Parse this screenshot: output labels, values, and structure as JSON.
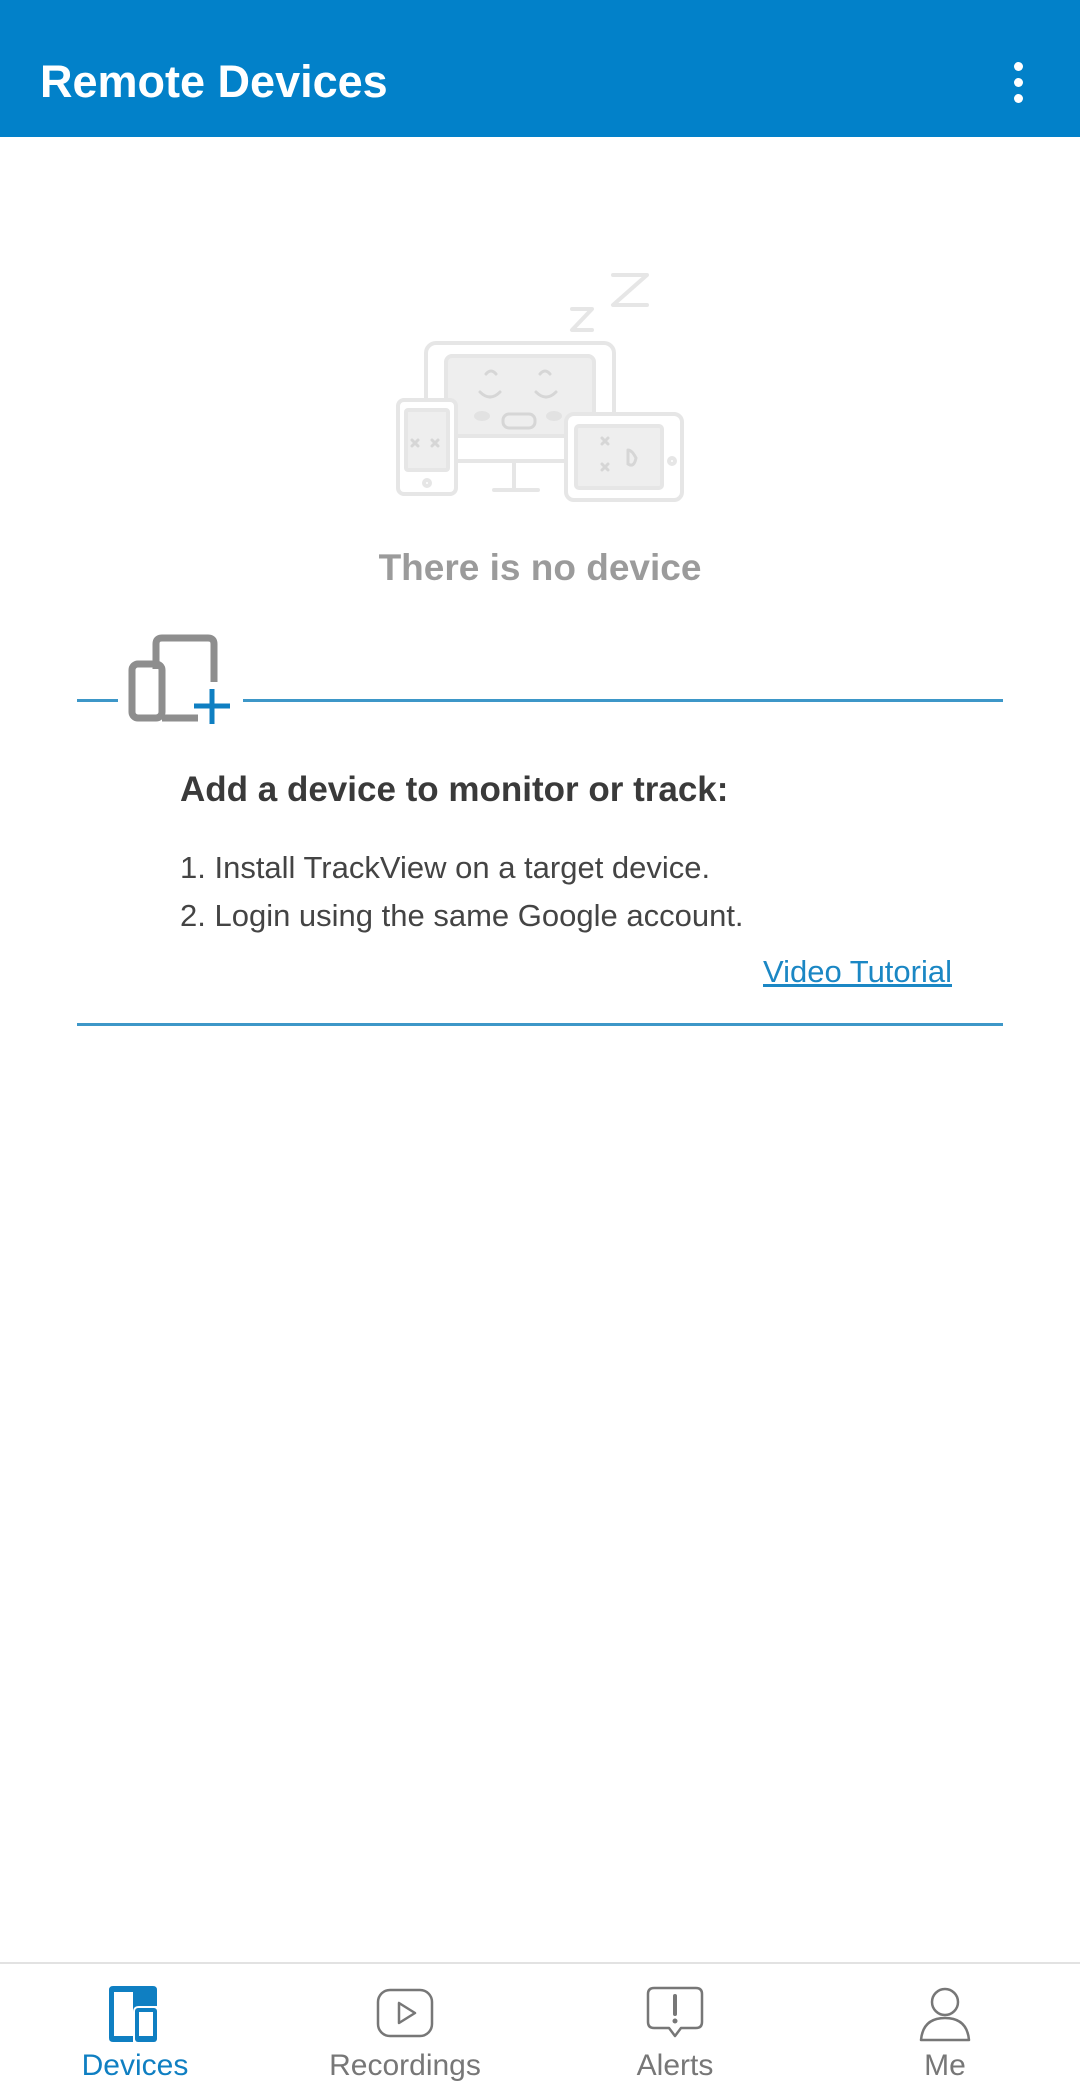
{
  "app_bar": {
    "title": "Remote Devices",
    "menu_icon": "more-vert-icon",
    "background": "#0281c9"
  },
  "empty_state": {
    "message": "There is no device",
    "illustration": "sleeping-devices-illustration"
  },
  "add_device": {
    "icon": "add-device-icon",
    "heading": "Add a device to monitor or track:",
    "steps": [
      "1. Install TrackView on a target device.",
      "2. Login using the same Google account."
    ],
    "tutorial_link": "Video Tutorial"
  },
  "bottom_nav": {
    "items": [
      {
        "label": "Devices",
        "icon": "devices-icon",
        "active": true
      },
      {
        "label": "Recordings",
        "icon": "play-icon",
        "active": false
      },
      {
        "label": "Alerts",
        "icon": "alert-icon",
        "active": false
      },
      {
        "label": "Me",
        "icon": "person-icon",
        "active": false
      }
    ],
    "active_color": "#0f7fc2",
    "inactive_color": "#777777"
  }
}
